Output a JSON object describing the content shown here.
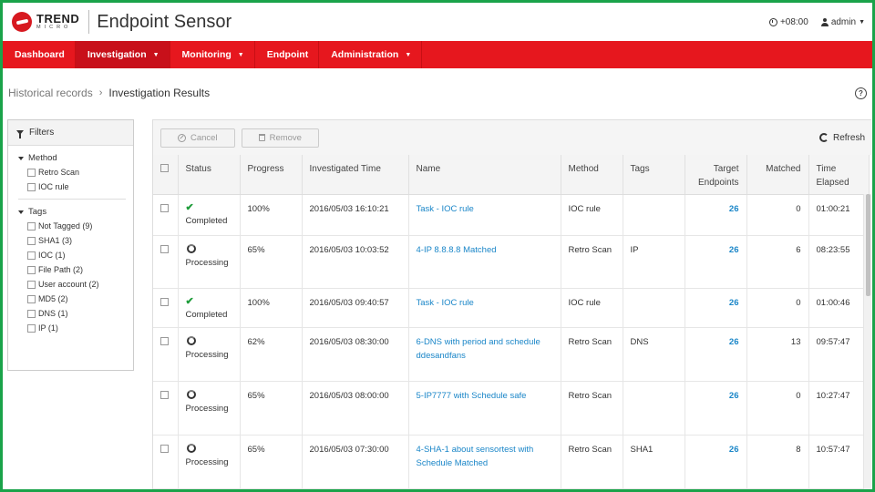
{
  "header": {
    "logo_trend": "TREND",
    "logo_micro": "MICRO",
    "app_title": "Endpoint Sensor",
    "timezone": "+08:00",
    "user": "admin"
  },
  "nav": {
    "items": [
      {
        "label": "Dashboard"
      },
      {
        "label": "Investigation"
      },
      {
        "label": "Monitoring"
      },
      {
        "label": "Endpoint"
      },
      {
        "label": "Administration"
      }
    ]
  },
  "breadcrumb": {
    "parent": "Historical records",
    "separator": "›",
    "current": "Investigation Results"
  },
  "filters": {
    "title": "Filters",
    "method": {
      "title": "Method",
      "options": [
        "Retro Scan",
        "IOC rule"
      ]
    },
    "tags": {
      "title": "Tags",
      "options": [
        "Not Tagged (9)",
        "SHA1 (3)",
        "IOC (1)",
        "File Path (2)",
        "User account (2)",
        "MD5 (2)",
        "DNS (1)",
        "IP (1)"
      ]
    }
  },
  "toolbar": {
    "cancel_label": "Cancel",
    "remove_label": "Remove",
    "refresh_label": "Refresh"
  },
  "table": {
    "columns": {
      "status": "Status",
      "progress": "Progress",
      "investigated_time": "Investigated Time",
      "name": "Name",
      "method": "Method",
      "tags": "Tags",
      "target_endpoints": "Target Endpoints",
      "matched": "Matched",
      "time_elapsed": "Time Elapsed"
    },
    "rows": [
      {
        "status": "Completed",
        "progress": "100%",
        "time": "2016/05/03 16:10:21",
        "name": "Task - IOC rule",
        "method": "IOC rule",
        "tags": "",
        "target": "26",
        "matched": "0",
        "elapsed": "01:00:21"
      },
      {
        "status": "Processing",
        "progress": "65%",
        "time": "2016/05/03 10:03:52",
        "name": "4-IP 8.8.8.8 Matched",
        "method": "Retro Scan",
        "tags": "IP",
        "target": "26",
        "matched": "6",
        "elapsed": "08:23:55"
      },
      {
        "status": "Completed",
        "progress": "100%",
        "time": "2016/05/03 09:40:57",
        "name": "Task - IOC rule",
        "method": "IOC rule",
        "tags": "",
        "target": "26",
        "matched": "0",
        "elapsed": "01:00:46"
      },
      {
        "status": "Processing",
        "progress": "62%",
        "time": "2016/05/03 08:30:00",
        "name": "6-DNS with period and schedule ddesandfans",
        "method": "Retro Scan",
        "tags": "DNS",
        "target": "26",
        "matched": "13",
        "elapsed": "09:57:47"
      },
      {
        "status": "Processing",
        "progress": "65%",
        "time": "2016/05/03 08:00:00",
        "name": "5-IP7777 with Schedule safe",
        "method": "Retro Scan",
        "tags": "",
        "target": "26",
        "matched": "0",
        "elapsed": "10:27:47"
      },
      {
        "status": "Processing",
        "progress": "65%",
        "time": "2016/05/03 07:30:00",
        "name": "4-SHA-1 about sensortest with Schedule Matched",
        "method": "Retro Scan",
        "tags": "SHA1",
        "target": "26",
        "matched": "8",
        "elapsed": "10:57:47"
      }
    ]
  },
  "colors": {
    "nav_red": "#e6171e",
    "link_blue": "#1a86c8",
    "completed_green": "#1e9c3a",
    "frame_green": "#1aa34a"
  },
  "icons": [
    "clock-icon",
    "user-icon",
    "filter-icon",
    "cancel-icon",
    "trash-icon",
    "refresh-icon",
    "help-icon",
    "check-icon",
    "processing-icon"
  ]
}
